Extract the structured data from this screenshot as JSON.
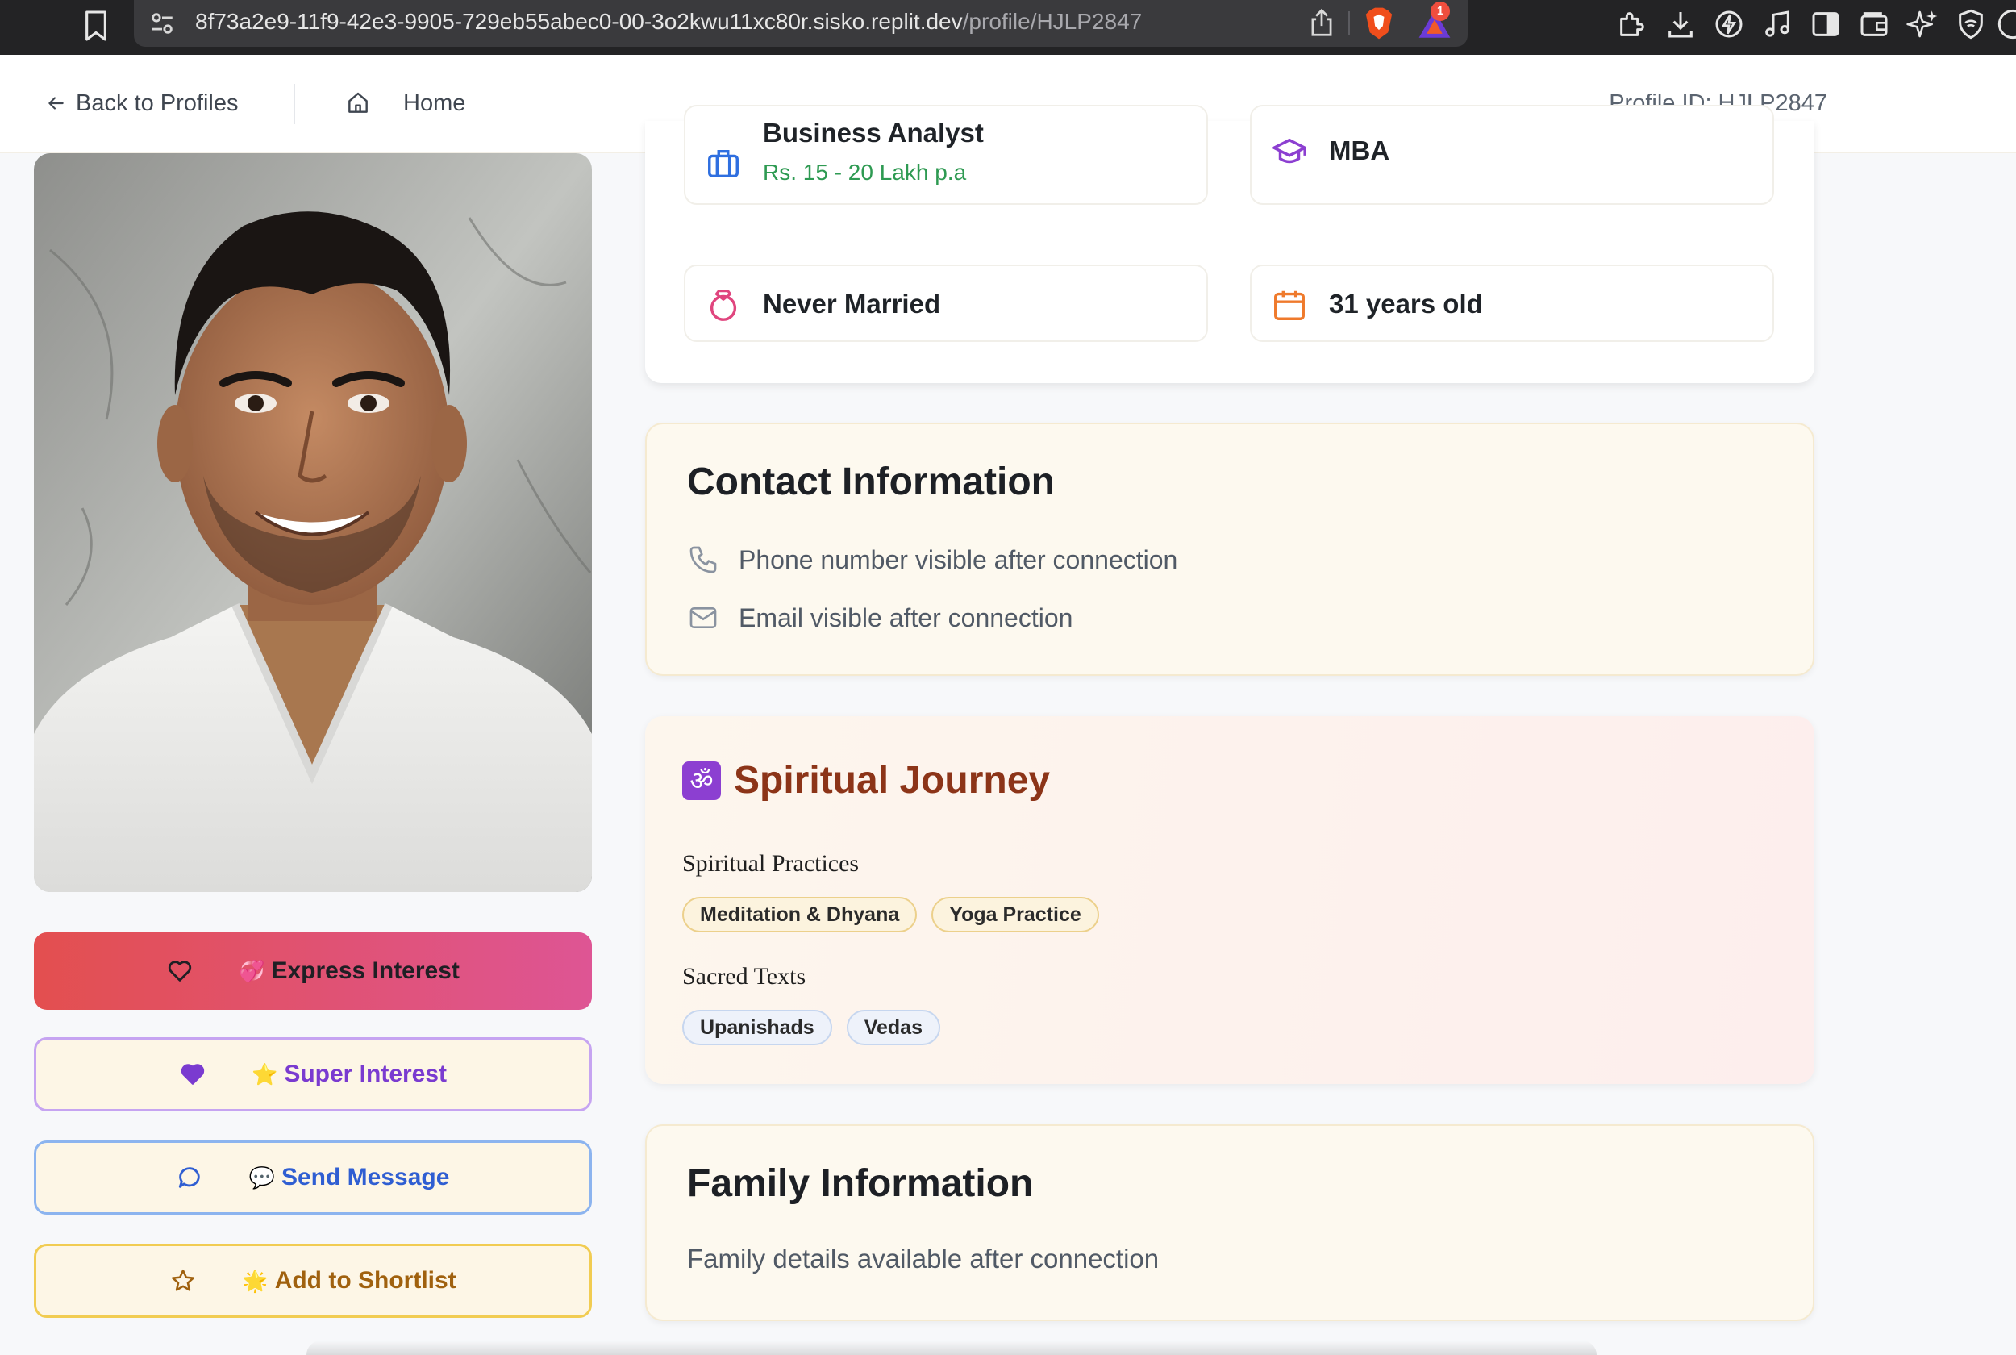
{
  "browser": {
    "url_host": "8f73a2e9-11f9-42e3-9905-729eb55abec0-00-3o2kwu11xc80r.sisko.replit.dev",
    "url_path": "/profile/HJLP2847",
    "rewards_badge": "1",
    "extension_icons": [
      "puzzle-icon",
      "download-icon",
      "leo-icon",
      "music-icon",
      "sidebar-icon",
      "wallet-icon",
      "sparkle-icon",
      "vpn-shield-icon"
    ]
  },
  "nav": {
    "back_label": "Back to Profiles",
    "home_label": "Home",
    "profile_id": "Profile ID: HJLP2847"
  },
  "actions": {
    "express": {
      "label": "Express Interest",
      "emoji": "💞"
    },
    "super": {
      "label": "Super Interest",
      "emoji": "⭐"
    },
    "message": {
      "label": "Send Message",
      "emoji": "💬"
    },
    "shortlist": {
      "label": "Add to Shortlist",
      "emoji": "🌟"
    }
  },
  "details": {
    "occupation": "Business Analyst",
    "income": "Rs. 15 - 20 Lakh p.a",
    "education": "MBA",
    "marital_status": "Never Married",
    "age": "31 years old"
  },
  "contact": {
    "title": "Contact Information",
    "phone": "Phone number visible after connection",
    "email": "Email visible after connection"
  },
  "spiritual": {
    "icon": "ॐ",
    "title": "Spiritual Journey",
    "practices_heading": "Spiritual Practices",
    "practices": [
      "Meditation & Dhyana",
      "Yoga Practice"
    ],
    "texts_heading": "Sacred Texts",
    "texts": [
      "Upanishads",
      "Vedas"
    ]
  },
  "family": {
    "title": "Family Information",
    "text": "Family details available after connection"
  },
  "colors": {
    "express_start": "#e34f4f",
    "express_end": "#de5594",
    "super_accent": "#7a3bd0",
    "message_accent": "#2f5ed2",
    "shortlist_accent": "#a0610e",
    "income_green": "#2e9a52",
    "spiritual_title": "#8c3418"
  }
}
